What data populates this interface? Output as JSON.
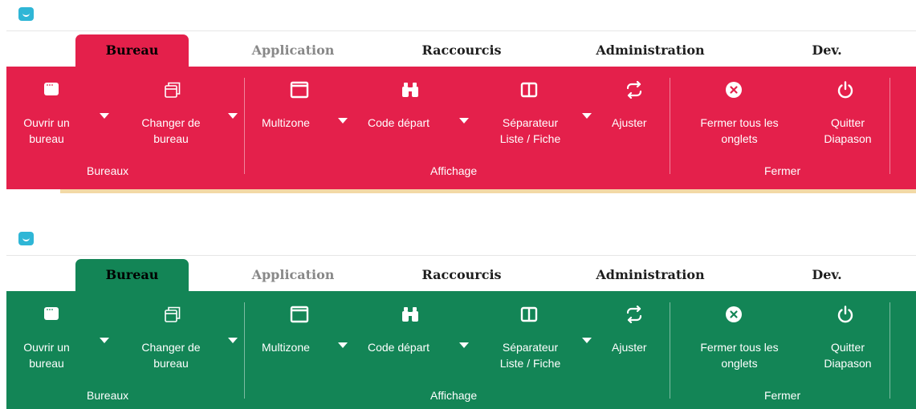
{
  "variants": [
    {
      "theme": "red",
      "color": "#e4204b",
      "tabs": [
        "Bureau",
        "Application",
        "Raccourcis",
        "Administration",
        "Dev."
      ],
      "groups": {
        "bureaux": {
          "label": "Bureaux"
        },
        "affichage": {
          "label": "Affichage"
        },
        "fermer": {
          "label": "Fermer"
        }
      },
      "buttons": {
        "ouvrir": {
          "label1": "Ouvrir un",
          "label2": "bureau",
          "icon": "window-icon",
          "dropdown": true
        },
        "changer": {
          "label1": "Changer de",
          "label2": "bureau",
          "icon": "stacked-windows-icon",
          "dropdown": true
        },
        "multizone": {
          "label1": "Multizone",
          "icon": "frame-icon",
          "dropdown": true
        },
        "code_depart": {
          "label1": "Code départ",
          "icon": "binoculars-icon",
          "dropdown": true
        },
        "separateur": {
          "label1": "Séparateur",
          "label2": "Liste / Fiche",
          "icon": "split-columns-icon",
          "dropdown": true
        },
        "ajuster": {
          "label1": "Ajuster",
          "icon": "swap-arrows-icon"
        },
        "fermer_onglets": {
          "label1": "Fermer tous les",
          "label2": "onglets",
          "icon": "close-circle-icon"
        },
        "quitter": {
          "label1": "Quitter",
          "label2": "Diapason",
          "icon": "power-icon"
        }
      }
    },
    {
      "theme": "green",
      "color": "#138556",
      "tabs": [
        "Bureau",
        "Application",
        "Raccourcis",
        "Administration",
        "Dev."
      ],
      "groups": {
        "bureaux": {
          "label": "Bureaux"
        },
        "affichage": {
          "label": "Affichage"
        },
        "fermer": {
          "label": "Fermer"
        }
      },
      "buttons": {
        "ouvrir": {
          "label1": "Ouvrir un",
          "label2": "bureau",
          "icon": "window-icon",
          "dropdown": true
        },
        "changer": {
          "label1": "Changer de",
          "label2": "bureau",
          "icon": "stacked-windows-icon",
          "dropdown": true
        },
        "multizone": {
          "label1": "Multizone",
          "icon": "frame-icon",
          "dropdown": true
        },
        "code_depart": {
          "label1": "Code départ",
          "icon": "binoculars-icon",
          "dropdown": true
        },
        "separateur": {
          "label1": "Séparateur",
          "label2": "Liste / Fiche",
          "icon": "split-columns-icon",
          "dropdown": true
        },
        "ajuster": {
          "label1": "Ajuster",
          "icon": "swap-arrows-icon"
        },
        "fermer_onglets": {
          "label1": "Fermer tous les",
          "label2": "onglets",
          "icon": "close-circle-icon"
        },
        "quitter": {
          "label1": "Quitter",
          "label2": "Diapason",
          "icon": "power-icon"
        }
      }
    }
  ],
  "accent": {
    "app_icon": "#2fb6d6",
    "underline": "#f3d9a6"
  }
}
